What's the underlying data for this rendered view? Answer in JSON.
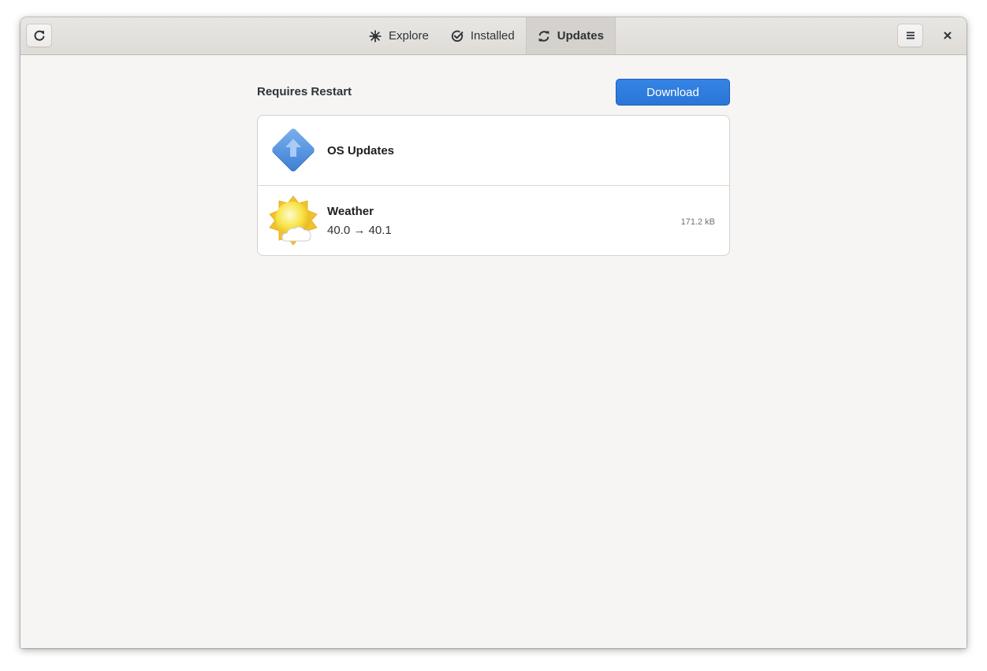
{
  "colors": {
    "accent": "#3584e4",
    "window_bg": "#f6f5f4",
    "headerbar_bg": "#e3e1de"
  },
  "headerbar": {
    "refresh_icon": "refresh-icon",
    "menu_icon": "hamburger-menu-icon",
    "close_icon": "close-icon",
    "tabs": [
      {
        "label": "Explore",
        "icon": "explore-icon",
        "active": false
      },
      {
        "label": "Installed",
        "icon": "check-circle-icon",
        "active": false
      },
      {
        "label": "Updates",
        "icon": "sync-icon",
        "active": true
      }
    ]
  },
  "main": {
    "section_title": "Requires Restart",
    "download_label": "Download",
    "updates": [
      {
        "name": "OS Updates",
        "icon": "os-updates-icon",
        "version": "",
        "size": ""
      },
      {
        "name": "Weather",
        "icon": "weather-icon",
        "version": "40.0 → 40.1",
        "size": "171.2 kB"
      }
    ]
  }
}
